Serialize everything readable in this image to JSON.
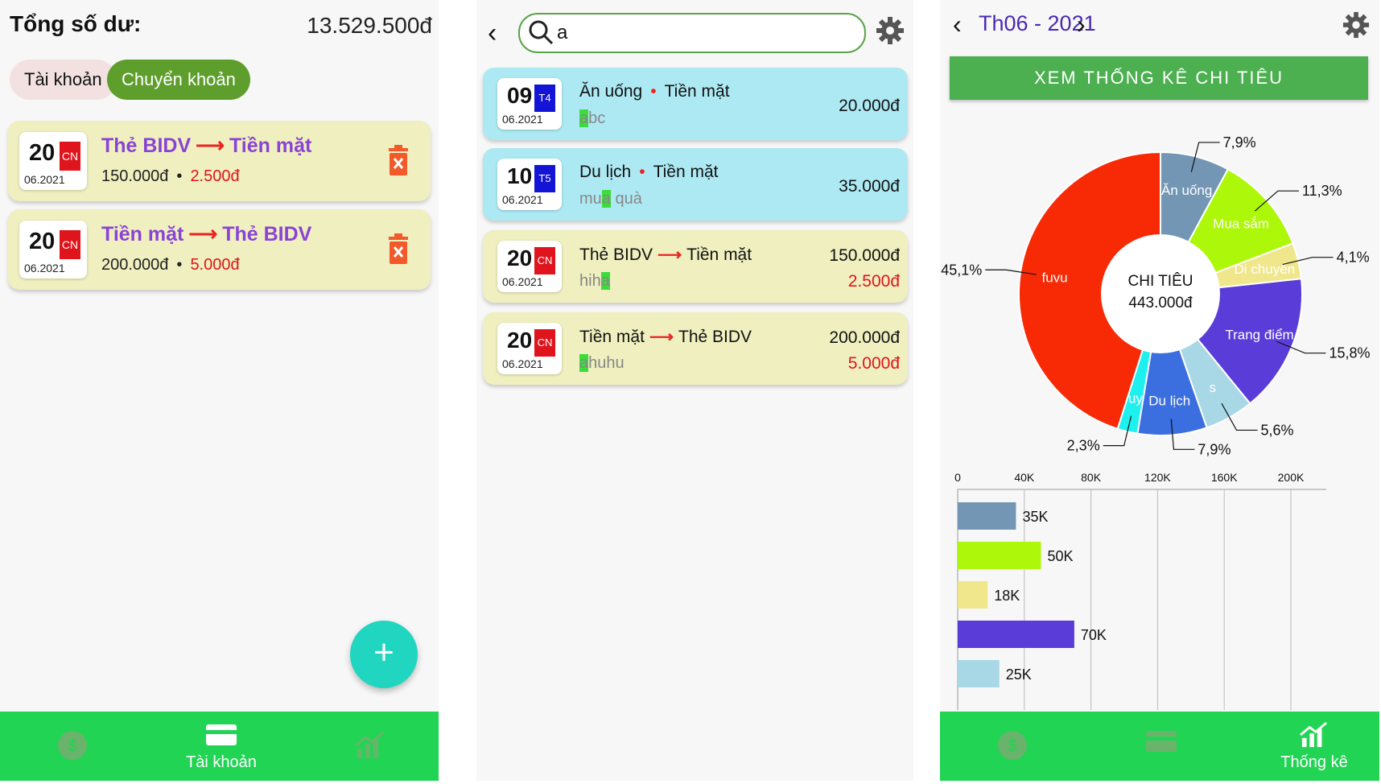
{
  "screen_accounts": {
    "balance_label": "Tổng số dư:",
    "balance_value": "13.529.500đ",
    "tabs": [
      "Tài khoản",
      "Chuyển khoản"
    ],
    "transfers": [
      {
        "day": "20",
        "dow": "CN",
        "month_year": "06.2021",
        "from": "Thẻ BIDV",
        "to": "Tiền mặt",
        "amount": "150.000đ",
        "fee": "2.500đ"
      },
      {
        "day": "20",
        "dow": "CN",
        "month_year": "06.2021",
        "from": "Tiền mặt",
        "to": "Thẻ BIDV",
        "amount": "200.000đ",
        "fee": "5.000đ"
      }
    ],
    "fab_label": "+",
    "nav": {
      "wallet": "",
      "accounts": "Tài khoản",
      "stats": ""
    }
  },
  "screen_search": {
    "query": "a",
    "results": [
      {
        "day": "09",
        "dow": "T4",
        "month_year": "06.2021",
        "category": "Ăn uống",
        "account": "Tiền mặt",
        "note_hl": "a",
        "note_rest": "bc",
        "amount": "20.000đ",
        "color": "blue"
      },
      {
        "day": "10",
        "dow": "T5",
        "month_year": "06.2021",
        "category": "Du lịch",
        "account": "Tiền mặt",
        "note_pre": "mu",
        "note_hl": "a",
        "note_rest": " quà",
        "amount": "35.000đ",
        "color": "blue"
      },
      {
        "day": "20",
        "dow": "CN",
        "month_year": "06.2021",
        "from": "Thẻ BIDV",
        "to": "Tiền mặt",
        "note_pre": "hih",
        "note_hl": "a",
        "amount": "150.000đ",
        "fee": "2.500đ",
        "color": "yellow"
      },
      {
        "day": "20",
        "dow": "CN",
        "month_year": "06.2021",
        "from": "Tiền mặt",
        "to": "Thẻ BIDV",
        "note_hl": "a",
        "note_rest": "huhu",
        "amount": "200.000đ",
        "fee": "5.000đ",
        "color": "yellow"
      }
    ]
  },
  "screen_stats": {
    "month": "Th06 - 2021",
    "stats_button": "XEM THỐNG KÊ CHI TIÊU",
    "center_title": "CHI TIÊU",
    "center_total": "443.000đ",
    "nav": {
      "wallet": "",
      "accounts": "",
      "stats": "Thống kê"
    }
  },
  "chart_data": [
    {
      "type": "pie",
      "title": "",
      "slices": [
        {
          "name": "Ăn uống",
          "value": 7.9,
          "label": "7,9%",
          "color": "#7396b4"
        },
        {
          "name": "Mua sắm",
          "value": 11.3,
          "label": "11,3%",
          "color": "#adf80a"
        },
        {
          "name": "Di chuyển",
          "value": 4.1,
          "label": "4,1%",
          "color": "#f0e68c"
        },
        {
          "name": "Trang điểm",
          "value": 15.8,
          "label": "15,8%",
          "color": "#5a3cd8"
        },
        {
          "name": "s",
          "value": 5.6,
          "label": "5,6%",
          "color": "#a8d8e6"
        },
        {
          "name": "Du lịch",
          "value": 7.9,
          "label": "7,9%",
          "color": "#3b6fe0"
        },
        {
          "name": "uy",
          "value": 2.3,
          "label": "2,3%",
          "color": "#1ef0f0"
        },
        {
          "name": "fuvu",
          "value": 45.1,
          "label": "45,1%",
          "color": "#f72a05"
        }
      ]
    },
    {
      "type": "bar",
      "orientation": "horizontal",
      "x_ticks": [
        "0",
        "40K",
        "80K",
        "120K",
        "160K",
        "200K"
      ],
      "xlim": [
        0,
        200000
      ],
      "bars": [
        {
          "value": 35000,
          "label": "35K",
          "color": "#7396b4"
        },
        {
          "value": 50000,
          "label": "50K",
          "color": "#adf80a"
        },
        {
          "value": 18000,
          "label": "18K",
          "color": "#f0e68c"
        },
        {
          "value": 70000,
          "label": "70K",
          "color": "#5a3cd8"
        },
        {
          "value": 25000,
          "label": "25K",
          "color": "#a8d8e6"
        }
      ],
      "grid": true
    }
  ]
}
